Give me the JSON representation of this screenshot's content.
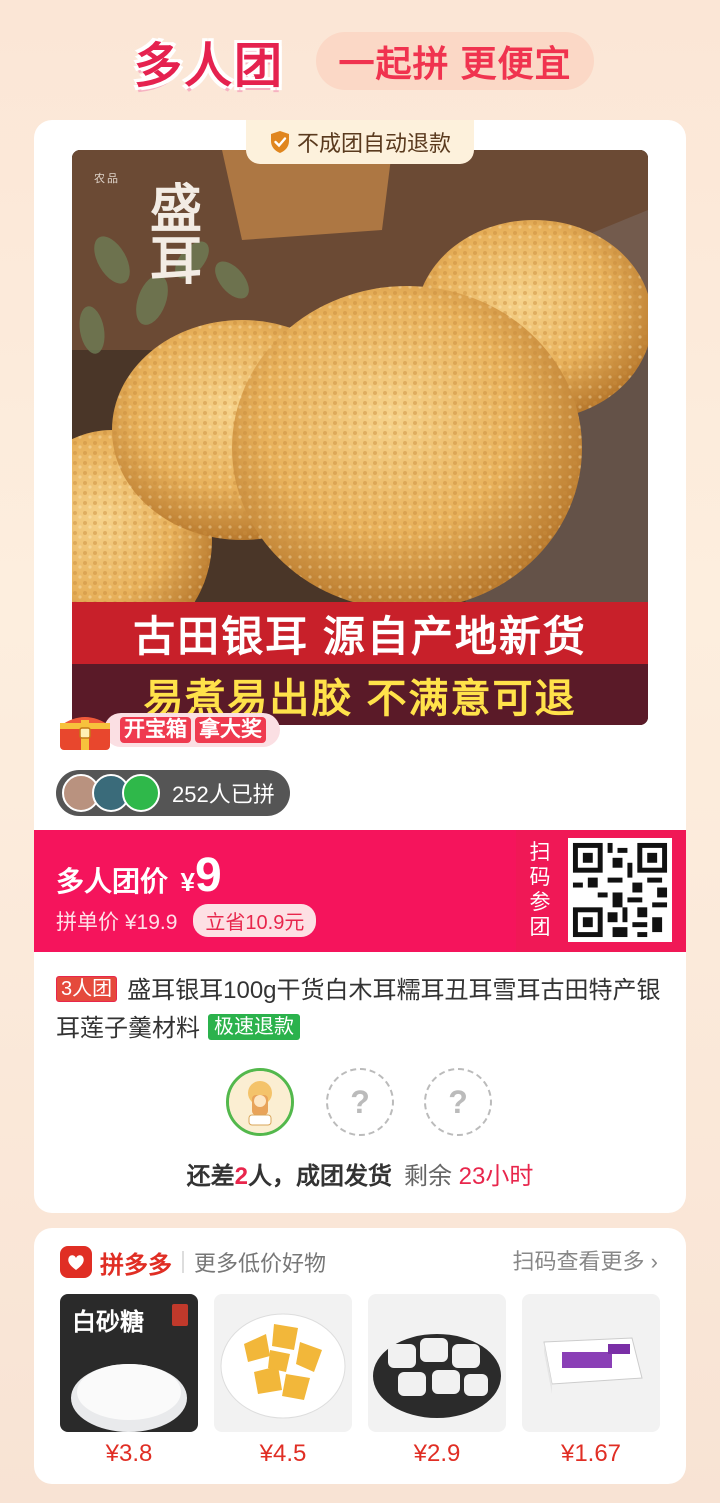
{
  "header": {
    "title": "多人团",
    "slogan": "一起拼 更便宜"
  },
  "badge": {
    "text": "不成团自动退款",
    "icon": "shield-check-icon"
  },
  "image": {
    "brand_small": "农品",
    "brand_big": "盛耳",
    "banner_line1": "古田银耳 源自产地新货",
    "banner_line2": "易煮易出胶 不满意可退"
  },
  "treasure": {
    "tag1": "开宝箱",
    "tag2": "拿大奖"
  },
  "joined": {
    "text": "252人已拼"
  },
  "price": {
    "label": "多人团价",
    "currency": "¥",
    "value": "9",
    "single_label": "拼单价 ¥19.9",
    "save": "立省10.9元",
    "qr_label": "扫码参团"
  },
  "product": {
    "group_tag": "3人团",
    "title": "盛耳银耳100g干货白木耳糯耳丑耳雪耳古田特产银耳莲子羹材料",
    "refund_tag": "极速退款"
  },
  "members": {
    "empty_mark": "?"
  },
  "status": {
    "prefix": "还差",
    "count": "2",
    "suffix": "人，成团发货",
    "remain_label": "剩余",
    "remain_time": "23小时"
  },
  "recommend": {
    "brand": "拼多多",
    "subtitle": "更多低价好物",
    "more": "扫码查看更多",
    "items": [
      {
        "price": "¥3.8",
        "thumb_text": "白砂糖"
      },
      {
        "price": "¥4.5"
      },
      {
        "price": "¥2.9"
      },
      {
        "price": "¥1.67"
      }
    ]
  },
  "colors": {
    "brand_red": "#f5145c",
    "green": "#2bb24c",
    "pdd_red": "#e02e24"
  }
}
